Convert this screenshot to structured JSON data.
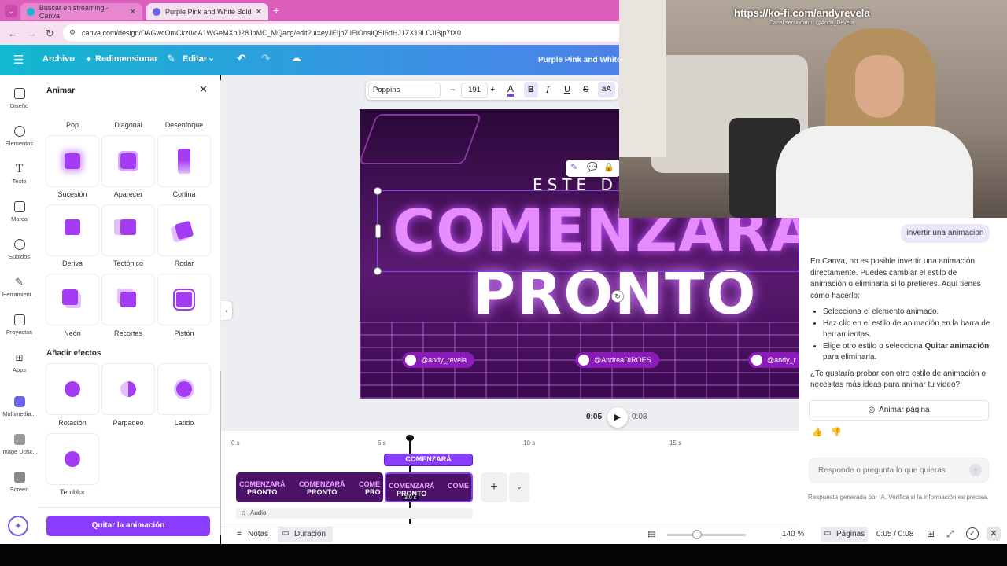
{
  "browser": {
    "tabs": [
      {
        "label": "Buscar en streaming - Canva"
      },
      {
        "label": "Purple Pink and White Bold Ne"
      }
    ],
    "url": "canva.com/design/DAGwcOmCkz0/cA1WGeMXpJ28JpMC_MQacg/edit?ui=eyJEIjp7IlEiOnsiQSI6dHJ1ZX19LCJlBjp7fX0"
  },
  "header": {
    "archivo": "Archivo",
    "redimensionar": "Redimensionar",
    "editar": "Editar",
    "doc_title": "Purple Pink and White"
  },
  "rail": [
    {
      "label": "Diseño"
    },
    {
      "label": "Elementos"
    },
    {
      "label": "Texto"
    },
    {
      "label": "Marca"
    },
    {
      "label": "Subidos"
    },
    {
      "label": "Herramient..."
    },
    {
      "label": "Proyectos"
    },
    {
      "label": "Apps"
    },
    {
      "label": "Multimedia..."
    },
    {
      "label": "Image Upsc..."
    },
    {
      "label": "Screen"
    }
  ],
  "panel": {
    "title": "Animar",
    "top_labels": [
      "Pop",
      "Diagonal",
      "Desenfoque"
    ],
    "row1": [
      "Sucesión",
      "Aparecer",
      "Cortina"
    ],
    "row2": [
      "Deriva",
      "Tectónico",
      "Rodar"
    ],
    "row3": [
      "Neón",
      "Recortes",
      "Pistón"
    ],
    "effects_heading": "Añadir efectos",
    "effects_row1": [
      "Rotación",
      "Parpadeo",
      "Latido"
    ],
    "effects_row2": [
      "Temblor"
    ],
    "remove_button": "Quitar la animación"
  },
  "font_toolbar": {
    "font": "Poppins",
    "size": "191",
    "minus": "–",
    "plus": "+",
    "letter_a": "A",
    "bold": "B",
    "italic": "I",
    "underline": "U",
    "strike": "S",
    "case": "aA"
  },
  "design": {
    "line1": "ESTE DI",
    "line2": "COMENZARÁ",
    "line3": "PRONTO",
    "socials": [
      "@andy_revela",
      "@AndreaDIROES",
      "@andy_r"
    ]
  },
  "playback": {
    "current": "0:05",
    "total": "0:08"
  },
  "timeline": {
    "ticks": [
      "0 s",
      "5 s",
      "10 s",
      "15 s"
    ],
    "caption_label": "COMENZARÁ",
    "clip_text_top": "COMENZARÁ",
    "clip_text_bottom": "PRONTO",
    "clip_text_cut_top": "COME",
    "clip_text_cut_bottom": "PRO",
    "clip_duration": "3.0 s",
    "audio_label": "Audio"
  },
  "bottombar": {
    "notas": "Notas",
    "duracion": "Duración",
    "zoom": "140 %",
    "paginas": "Páginas",
    "time": "0:05 / 0:08",
    "zoom_fraction": 0.38
  },
  "chat": {
    "user_message": "invertir una animacion",
    "reply_intro": "En Canva, no es posible invertir una animación directamente. Puedes cambiar el estilo de animación o eliminarla si lo prefieres. Aquí tienes cómo hacerlo:",
    "step1": "Selecciona el elemento animado.",
    "step2": "Haz clic en el estilo de animación en la barra de herramientas.",
    "step3_pre": "Elige otro estilo o selecciona ",
    "step3_bold": "Quitar animación",
    "step3_post": " para eliminarla.",
    "followup": "¿Te gustaría probar con otro estilo de animación o necesitas más ideas para animar tu video?",
    "animate_button": "Animar página",
    "input_placeholder": "Responde o pregunta lo que quieras",
    "disclaimer": "Respuesta generada por IA. Verifica si la información es precisa."
  },
  "webcam": {
    "overlay_url": "https://ko-fi.com/andyrevela",
    "overlay_sub": "Canal secundario: @Andy_Devela"
  },
  "colors": {
    "accent": "#8b3dff",
    "neon": "#d97bff"
  }
}
